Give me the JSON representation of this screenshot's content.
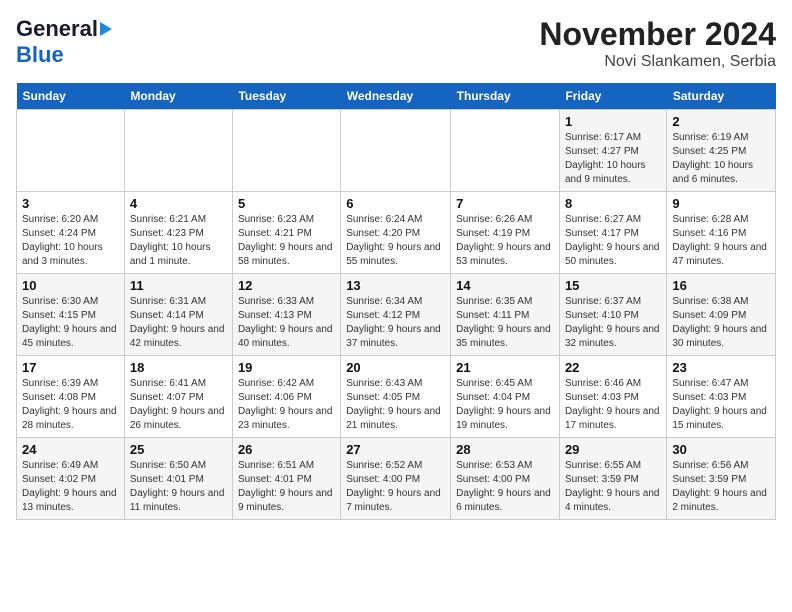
{
  "header": {
    "logo_line1": "General",
    "logo_line2": "Blue",
    "title": "November 2024",
    "subtitle": "Novi Slankamen, Serbia"
  },
  "days_of_week": [
    "Sunday",
    "Monday",
    "Tuesday",
    "Wednesday",
    "Thursday",
    "Friday",
    "Saturday"
  ],
  "weeks": [
    [
      {
        "day": "",
        "info": ""
      },
      {
        "day": "",
        "info": ""
      },
      {
        "day": "",
        "info": ""
      },
      {
        "day": "",
        "info": ""
      },
      {
        "day": "",
        "info": ""
      },
      {
        "day": "1",
        "info": "Sunrise: 6:17 AM\nSunset: 4:27 PM\nDaylight: 10 hours and 9 minutes."
      },
      {
        "day": "2",
        "info": "Sunrise: 6:19 AM\nSunset: 4:25 PM\nDaylight: 10 hours and 6 minutes."
      }
    ],
    [
      {
        "day": "3",
        "info": "Sunrise: 6:20 AM\nSunset: 4:24 PM\nDaylight: 10 hours and 3 minutes."
      },
      {
        "day": "4",
        "info": "Sunrise: 6:21 AM\nSunset: 4:23 PM\nDaylight: 10 hours and 1 minute."
      },
      {
        "day": "5",
        "info": "Sunrise: 6:23 AM\nSunset: 4:21 PM\nDaylight: 9 hours and 58 minutes."
      },
      {
        "day": "6",
        "info": "Sunrise: 6:24 AM\nSunset: 4:20 PM\nDaylight: 9 hours and 55 minutes."
      },
      {
        "day": "7",
        "info": "Sunrise: 6:26 AM\nSunset: 4:19 PM\nDaylight: 9 hours and 53 minutes."
      },
      {
        "day": "8",
        "info": "Sunrise: 6:27 AM\nSunset: 4:17 PM\nDaylight: 9 hours and 50 minutes."
      },
      {
        "day": "9",
        "info": "Sunrise: 6:28 AM\nSunset: 4:16 PM\nDaylight: 9 hours and 47 minutes."
      }
    ],
    [
      {
        "day": "10",
        "info": "Sunrise: 6:30 AM\nSunset: 4:15 PM\nDaylight: 9 hours and 45 minutes."
      },
      {
        "day": "11",
        "info": "Sunrise: 6:31 AM\nSunset: 4:14 PM\nDaylight: 9 hours and 42 minutes."
      },
      {
        "day": "12",
        "info": "Sunrise: 6:33 AM\nSunset: 4:13 PM\nDaylight: 9 hours and 40 minutes."
      },
      {
        "day": "13",
        "info": "Sunrise: 6:34 AM\nSunset: 4:12 PM\nDaylight: 9 hours and 37 minutes."
      },
      {
        "day": "14",
        "info": "Sunrise: 6:35 AM\nSunset: 4:11 PM\nDaylight: 9 hours and 35 minutes."
      },
      {
        "day": "15",
        "info": "Sunrise: 6:37 AM\nSunset: 4:10 PM\nDaylight: 9 hours and 32 minutes."
      },
      {
        "day": "16",
        "info": "Sunrise: 6:38 AM\nSunset: 4:09 PM\nDaylight: 9 hours and 30 minutes."
      }
    ],
    [
      {
        "day": "17",
        "info": "Sunrise: 6:39 AM\nSunset: 4:08 PM\nDaylight: 9 hours and 28 minutes."
      },
      {
        "day": "18",
        "info": "Sunrise: 6:41 AM\nSunset: 4:07 PM\nDaylight: 9 hours and 26 minutes."
      },
      {
        "day": "19",
        "info": "Sunrise: 6:42 AM\nSunset: 4:06 PM\nDaylight: 9 hours and 23 minutes."
      },
      {
        "day": "20",
        "info": "Sunrise: 6:43 AM\nSunset: 4:05 PM\nDaylight: 9 hours and 21 minutes."
      },
      {
        "day": "21",
        "info": "Sunrise: 6:45 AM\nSunset: 4:04 PM\nDaylight: 9 hours and 19 minutes."
      },
      {
        "day": "22",
        "info": "Sunrise: 6:46 AM\nSunset: 4:03 PM\nDaylight: 9 hours and 17 minutes."
      },
      {
        "day": "23",
        "info": "Sunrise: 6:47 AM\nSunset: 4:03 PM\nDaylight: 9 hours and 15 minutes."
      }
    ],
    [
      {
        "day": "24",
        "info": "Sunrise: 6:49 AM\nSunset: 4:02 PM\nDaylight: 9 hours and 13 minutes."
      },
      {
        "day": "25",
        "info": "Sunrise: 6:50 AM\nSunset: 4:01 PM\nDaylight: 9 hours and 11 minutes."
      },
      {
        "day": "26",
        "info": "Sunrise: 6:51 AM\nSunset: 4:01 PM\nDaylight: 9 hours and 9 minutes."
      },
      {
        "day": "27",
        "info": "Sunrise: 6:52 AM\nSunset: 4:00 PM\nDaylight: 9 hours and 7 minutes."
      },
      {
        "day": "28",
        "info": "Sunrise: 6:53 AM\nSunset: 4:00 PM\nDaylight: 9 hours and 6 minutes."
      },
      {
        "day": "29",
        "info": "Sunrise: 6:55 AM\nSunset: 3:59 PM\nDaylight: 9 hours and 4 minutes."
      },
      {
        "day": "30",
        "info": "Sunrise: 6:56 AM\nSunset: 3:59 PM\nDaylight: 9 hours and 2 minutes."
      }
    ]
  ]
}
